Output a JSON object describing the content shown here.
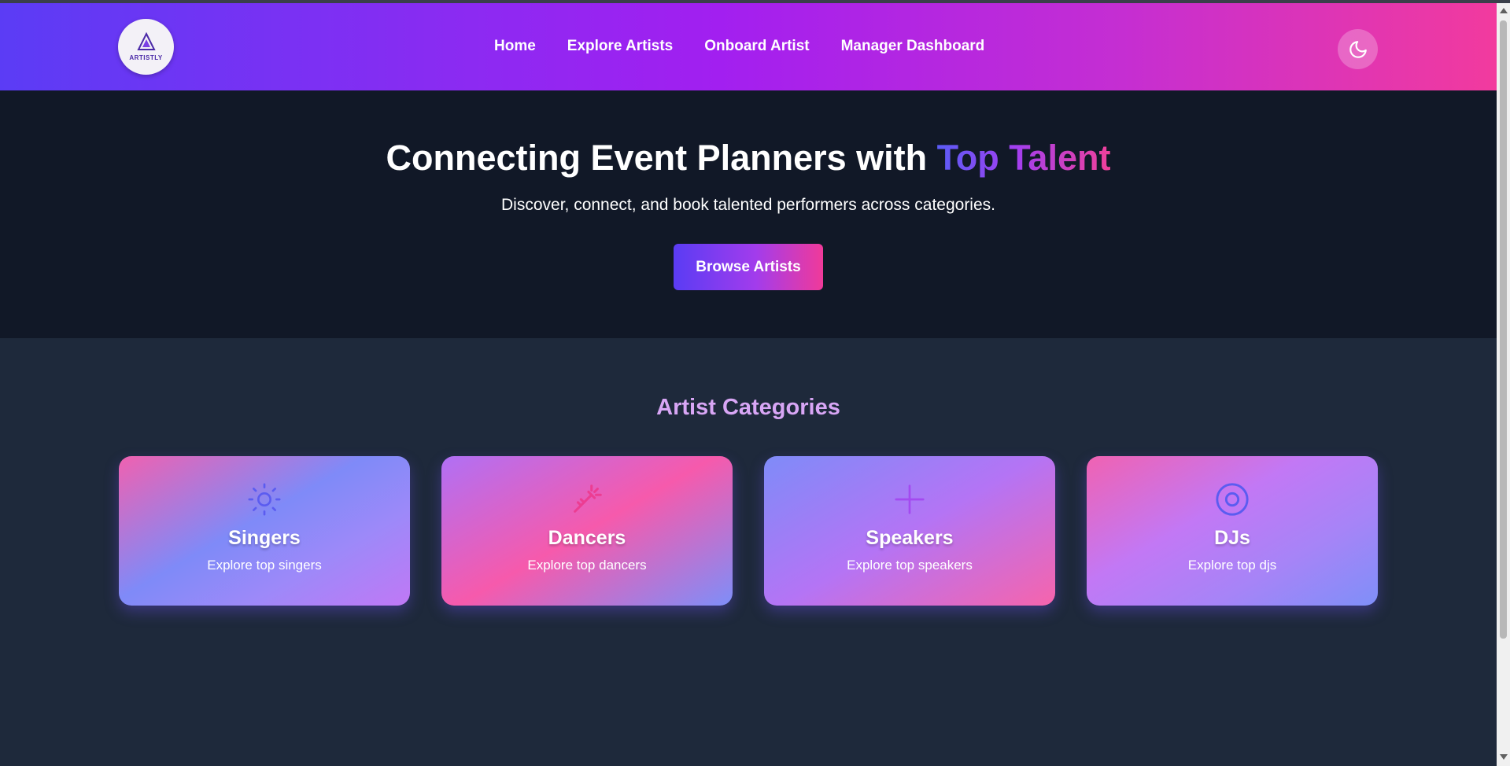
{
  "brand": {
    "logo_text": "ARTISTLY"
  },
  "nav": {
    "links": [
      {
        "label": "Home"
      },
      {
        "label": "Explore Artists"
      },
      {
        "label": "Onboard Artist"
      },
      {
        "label": "Manager Dashboard"
      }
    ],
    "theme_toggle_icon": "moon-icon"
  },
  "hero": {
    "title_prefix": "Connecting Event Planners with ",
    "title_accent": "Top Talent",
    "subtitle": "Discover, connect, and book talented performers across categories.",
    "cta_label": "Browse Artists"
  },
  "categories": {
    "title": "Artist Categories",
    "items": [
      {
        "title": "Singers",
        "description": "Explore top singers",
        "icon": "sun-icon",
        "icon_color": "#5b5cf0"
      },
      {
        "title": "Dancers",
        "description": "Explore top dancers",
        "icon": "wand-icon",
        "icon_color": "#ec3d92"
      },
      {
        "title": "Speakers",
        "description": "Explore top speakers",
        "icon": "plus-icon",
        "icon_color": "#a34af0"
      },
      {
        "title": "DJs",
        "description": "Explore top djs",
        "icon": "disc-icon",
        "icon_color": "#5b5cf0"
      }
    ]
  }
}
